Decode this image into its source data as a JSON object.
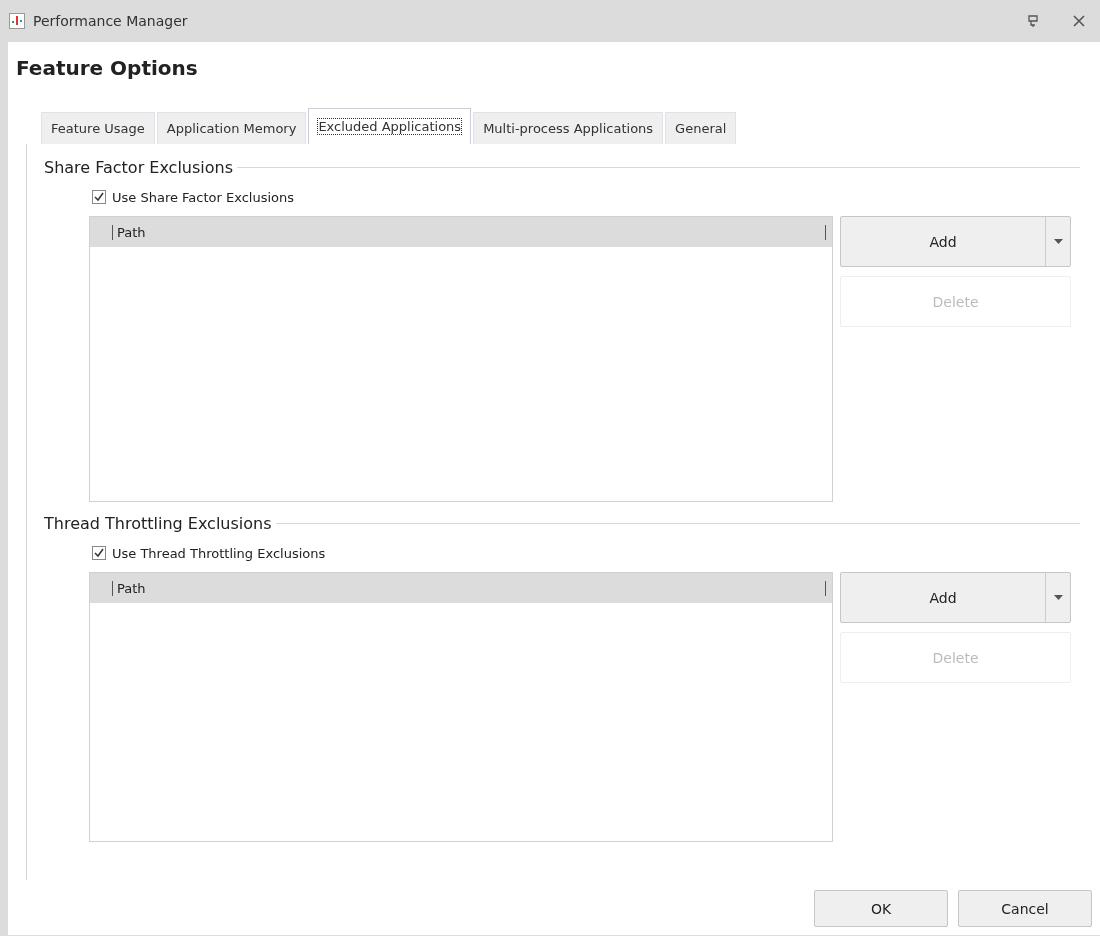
{
  "window": {
    "title": "Performance Manager"
  },
  "heading": "Feature Options",
  "tabs": [
    {
      "label": "Feature Usage",
      "selected": false
    },
    {
      "label": "Application Memory",
      "selected": false
    },
    {
      "label": "Excluded Applications",
      "selected": true
    },
    {
      "label": "Multi-process Applications",
      "selected": false
    },
    {
      "label": "General",
      "selected": false
    }
  ],
  "sections": [
    {
      "title": "Share Factor Exclusions",
      "checkbox": {
        "label": "Use Share Factor Exclusions",
        "checked": true
      },
      "columns": [
        "Path"
      ],
      "buttons": [
        {
          "label": "Add",
          "kind": "split",
          "disabled": false
        },
        {
          "label": "Delete",
          "kind": "plain",
          "disabled": true
        }
      ]
    },
    {
      "title": "Thread Throttling Exclusions",
      "checkbox": {
        "label": "Use Thread Throttling Exclusions",
        "checked": true
      },
      "columns": [
        "Path"
      ],
      "buttons": [
        {
          "label": "Add",
          "kind": "split",
          "disabled": false
        },
        {
          "label": "Delete",
          "kind": "plain",
          "disabled": true
        }
      ]
    }
  ],
  "footer_buttons": [
    "OK",
    "Cancel"
  ]
}
